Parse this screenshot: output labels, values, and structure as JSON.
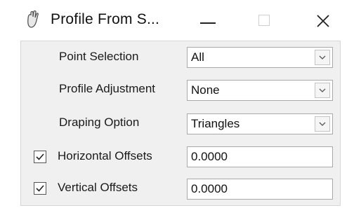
{
  "window": {
    "title": "Profile From S...",
    "app_icon": "hand-icon",
    "minimize_icon": "minimize-icon",
    "maximize_icon": "maximize-icon",
    "close_icon": "close-icon"
  },
  "form": {
    "point_selection": {
      "label": "Point Selection",
      "value": "All"
    },
    "profile_adjustment": {
      "label": "Profile Adjustment",
      "value": "None"
    },
    "draping_option": {
      "label": "Draping Option",
      "value": "Triangles"
    },
    "horizontal_offsets": {
      "label": "Horizontal Offsets",
      "value": "0.0000",
      "checked": true
    },
    "vertical_offsets": {
      "label": "Vertical Offsets",
      "value": "0.0000",
      "checked": true
    }
  }
}
